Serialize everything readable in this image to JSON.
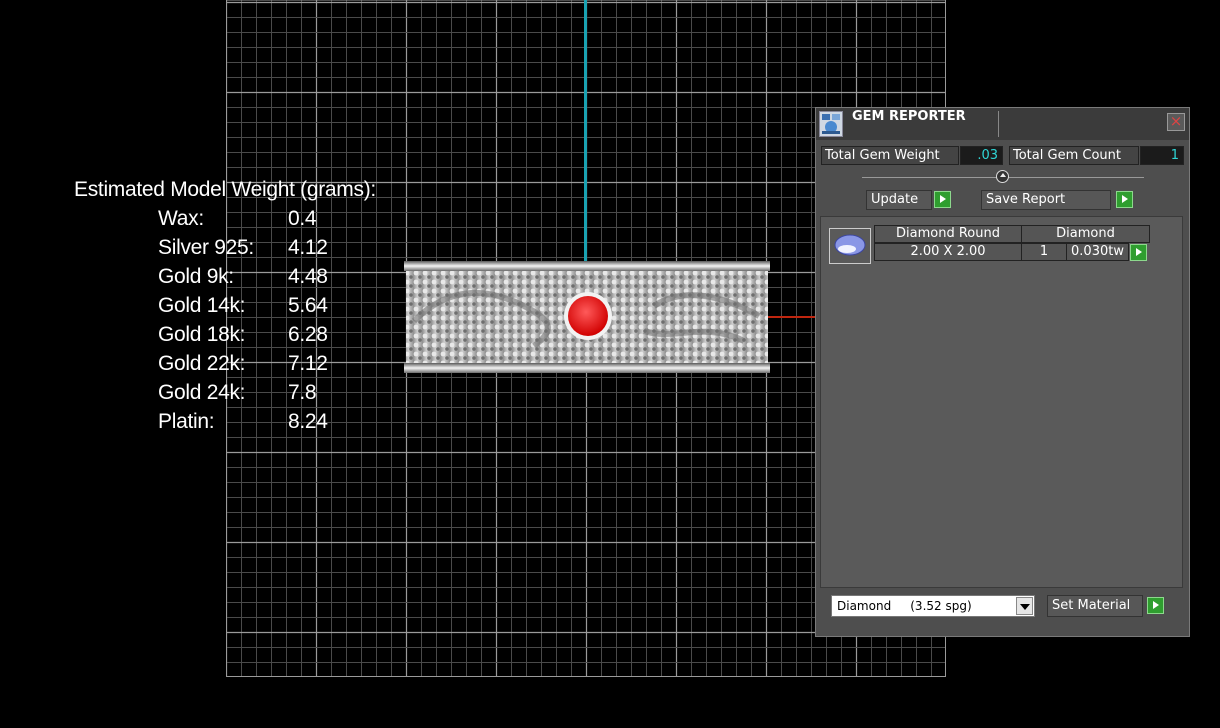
{
  "weights": {
    "title": "Estimated Model Weight (grams):",
    "rows": [
      {
        "label": "Wax:",
        "value": "0.4"
      },
      {
        "label": "Silver 925:",
        "value": "4.12"
      },
      {
        "label": "Gold 9k:",
        "value": "4.48"
      },
      {
        "label": "Gold 14k:",
        "value": "5.64"
      },
      {
        "label": "Gold 18k:",
        "value": "6.28"
      },
      {
        "label": "Gold 22k:",
        "value": "7.12"
      },
      {
        "label": "Gold 24k:",
        "value": "7.8"
      },
      {
        "label": "Platin:",
        "value": "8.24"
      }
    ]
  },
  "panel": {
    "title": "GEM REPORTER",
    "close_icon": "close-icon",
    "total_weight_label": "Total Gem Weight",
    "total_weight_value": ".03",
    "total_count_label": "Total Gem Count",
    "total_count_value": "1",
    "update_label": "Update",
    "save_label": "Save Report",
    "gem": {
      "shape": "Diamond Round",
      "size": "2.00 X 2.00",
      "material": "Diamond",
      "count": "1",
      "weight": "0.030tw"
    },
    "material_select": "Diamond     (3.52 spg)",
    "set_material_label": "Set Material"
  },
  "colors": {
    "background": "#000000",
    "grid": "#8a8a8a",
    "axis_vertical": "#1aa2b2",
    "axis_horizontal": "#c0260f",
    "panel": "#4e4e4e",
    "value_text": "#2fd6d6",
    "go_button": "#2f9e2f",
    "gem_stone": "#e00000"
  }
}
